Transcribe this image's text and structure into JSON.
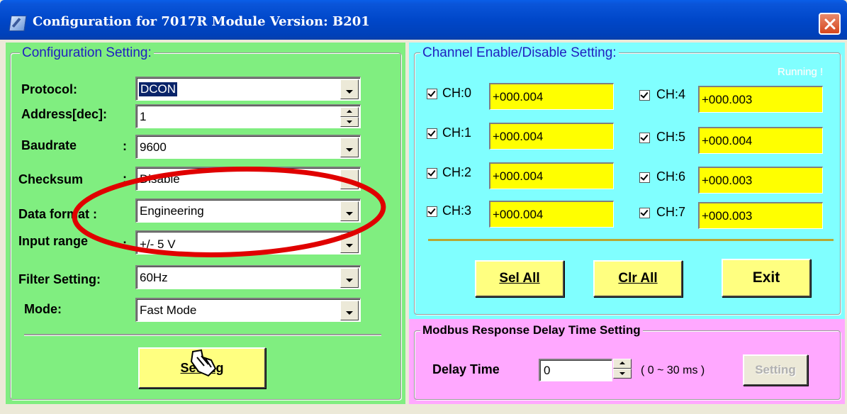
{
  "window": {
    "title": "Configuration for 7017R Module Version: B201"
  },
  "config": {
    "group_title": "Configuration Setting:",
    "fields": [
      {
        "label": "Protocol:",
        "value": "DCON"
      },
      {
        "label": "Address[dec]:",
        "value": "1"
      },
      {
        "label": "Baudrate",
        "value": "9600"
      },
      {
        "label": "Checksum",
        "value": "Disable"
      },
      {
        "label": "Data format :",
        "value": "Engineering"
      },
      {
        "label": "Input range",
        "value": "+/- 5 V"
      },
      {
        "label": "Filter Setting:",
        "value": "60Hz"
      },
      {
        "label": "Mode:",
        "value": "Fast Mode"
      }
    ],
    "setting_button": "Setting"
  },
  "channels": {
    "group_title": "Channel Enable/Disable Setting:",
    "status": "Running !",
    "items": [
      {
        "label": "CH:0",
        "value": "+000.004",
        "checked": true
      },
      {
        "label": "CH:1",
        "value": "+000.004",
        "checked": true
      },
      {
        "label": "CH:2",
        "value": "+000.004",
        "checked": true
      },
      {
        "label": "CH:3",
        "value": "+000.004",
        "checked": true
      },
      {
        "label": "CH:4",
        "value": "+000.003",
        "checked": true
      },
      {
        "label": "CH:5",
        "value": "+000.004",
        "checked": true
      },
      {
        "label": "CH:6",
        "value": "+000.003",
        "checked": true
      },
      {
        "label": "CH:7",
        "value": "+000.003",
        "checked": true
      }
    ],
    "sel_all": "Sel All",
    "clr_all": "Clr All",
    "exit": "Exit"
  },
  "modbus": {
    "group_title": "Modbus Response Delay Time Setting",
    "delay_label": "Delay Time",
    "delay_value": "0",
    "range_text": "( 0 ~ 30 ms )",
    "setting_button": "Setting"
  },
  "colors": {
    "config_bg": "#80ee80",
    "channel_bg": "#80ffff",
    "modbus_bg": "#ffa8ff",
    "button_bg": "#ffff80",
    "value_bg": "#ffff00",
    "annotation": "#e00000"
  }
}
